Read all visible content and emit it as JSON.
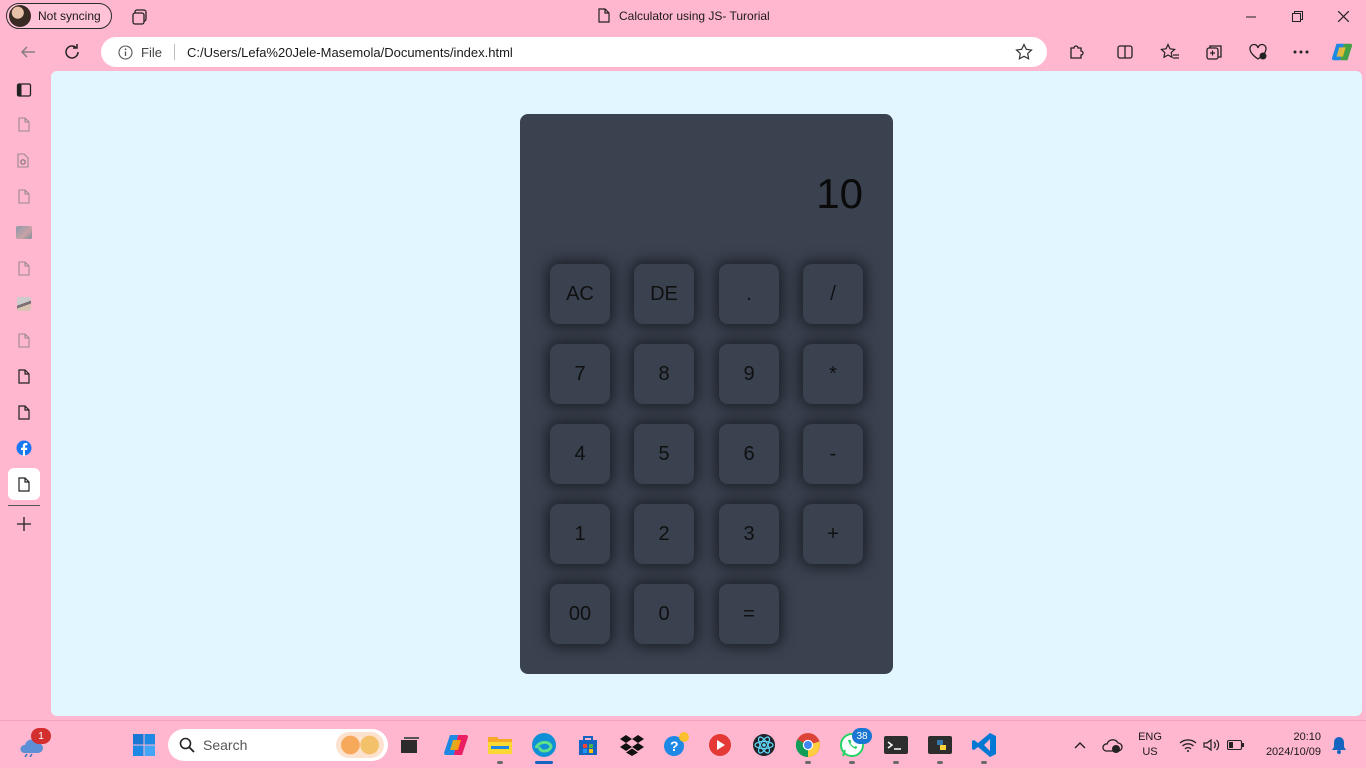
{
  "browser": {
    "profile_label": "Not syncing",
    "tab_title": "Calculator using JS- Turorial",
    "address": {
      "scheme_label": "File",
      "url": "C:/Users/Lefa%20Jele-Masemola/Documents/index.html"
    }
  },
  "calculator": {
    "display_value": "10",
    "keys": [
      [
        "AC",
        "DE",
        ".",
        "/"
      ],
      [
        "7",
        "8",
        "9",
        "*"
      ],
      [
        "4",
        "5",
        "6",
        "-"
      ],
      [
        "1",
        "2",
        "3",
        "+"
      ],
      [
        "00",
        "0",
        "="
      ]
    ]
  },
  "taskbar": {
    "search_placeholder": "Search",
    "weather_badge": "1",
    "whatsapp_badge": "38",
    "language": "ENG",
    "region": "US",
    "time": "20:10",
    "date": "2024/10/09"
  },
  "colors": {
    "chrome_pink": "#ffb6cf",
    "page_bg": "#e1f6fe",
    "calculator_bg": "#3a4250"
  }
}
